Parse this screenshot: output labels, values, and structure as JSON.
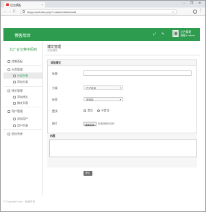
{
  "browser": {
    "tab_title": "后台模板",
    "tab_close": "×",
    "window_controls": "− ❐ ✕",
    "back": "←",
    "forward": "→",
    "reload": "C",
    "url": "blog.com/index.php?r=admin/article/add",
    "star": "☆",
    "menu": "⋮"
  },
  "header": {
    "brand": "博客后台",
    "icon1": "⤢",
    "icon2": "✎",
    "user_name": "后台管理",
    "user_role": "超级 ▸ admin"
  },
  "sidebar": {
    "title": "北广合亿菜中招商",
    "items": [
      {
        "label": "控制面板",
        "sub": false,
        "active": false
      },
      {
        "label": "分类管理",
        "sub": false,
        "active": false
      },
      {
        "label": "分类列表",
        "sub": true,
        "active": true
      },
      {
        "label": "添加分类",
        "sub": true,
        "active": false
      },
      {
        "label": "博文管理",
        "sub": false,
        "active": false
      },
      {
        "label": "添加博文",
        "sub": true,
        "active": false
      },
      {
        "label": "博文列表",
        "sub": true,
        "active": false
      },
      {
        "label": "用户管理",
        "sub": false,
        "active": false
      },
      {
        "label": "添加用户",
        "sub": true,
        "active": false
      },
      {
        "label": "用户列表",
        "sub": true,
        "active": false
      },
      {
        "label": "退出系统",
        "sub": false,
        "active": false
      }
    ]
  },
  "main": {
    "title": "博文管理",
    "subtitle": "添加博文",
    "panel_title": "添加博文",
    "form": {
      "title_label": "标题",
      "category_label": "分类",
      "category_value": "PHP技术",
      "tag_label": "标签",
      "tag_value": "请选择",
      "top_label": "置顶",
      "top_option_yes": "置顶",
      "top_option_no": "不置顶",
      "image_label": "图片",
      "file_button": "选择文件",
      "file_status": "未选择任何文件",
      "content_label": "内容",
      "submit_label": "提交"
    }
  },
  "footer": {
    "text": "© Copyright Color · 版权所有"
  },
  "colors": {
    "accent": "#2e9c4f"
  }
}
